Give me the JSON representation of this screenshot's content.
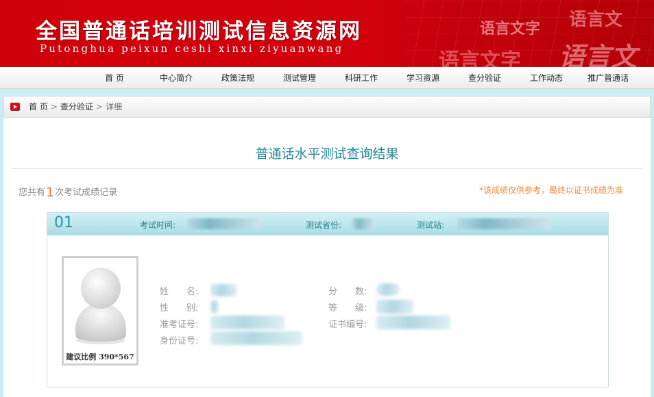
{
  "header": {
    "title": "全国普通话培训测试信息资源网",
    "subtitle": "Putonghua peixun ceshi xinxi ziyuanwang",
    "decor": [
      "语言文字",
      "语言文",
      "语言文字",
      "语言文"
    ]
  },
  "nav": {
    "items": [
      "首  页",
      "中心简介",
      "政策法规",
      "测试管理",
      "科研工作",
      "学习资源",
      "查分验证",
      "工作动态",
      "推广普通话"
    ]
  },
  "breadcrumb": {
    "home": "首 页",
    "section": "查分验证",
    "current": "详细",
    "sep": ">"
  },
  "result": {
    "title": "普通话水平测试查询结果",
    "count_prefix": "您共有",
    "count": "1",
    "count_suffix": "次考试成绩记录",
    "note": "*该成绩仅供参考，最终以证书成绩为准"
  },
  "record": {
    "number": "01",
    "exam_time_label": "考试时间:",
    "province_label": "测试省份:",
    "station_label": "测试站:",
    "photo_caption": "建议比例 390*567",
    "fields_left": [
      "姓　　名:",
      "性　　别:",
      "准考证号:",
      "身份证号:"
    ],
    "fields_right": [
      "分　　数:",
      "等　　级:",
      "证书编号:"
    ]
  },
  "colors": {
    "brand_red": "#d0000a",
    "title_teal": "#1f8a97",
    "note_orange": "#f28a3d"
  }
}
